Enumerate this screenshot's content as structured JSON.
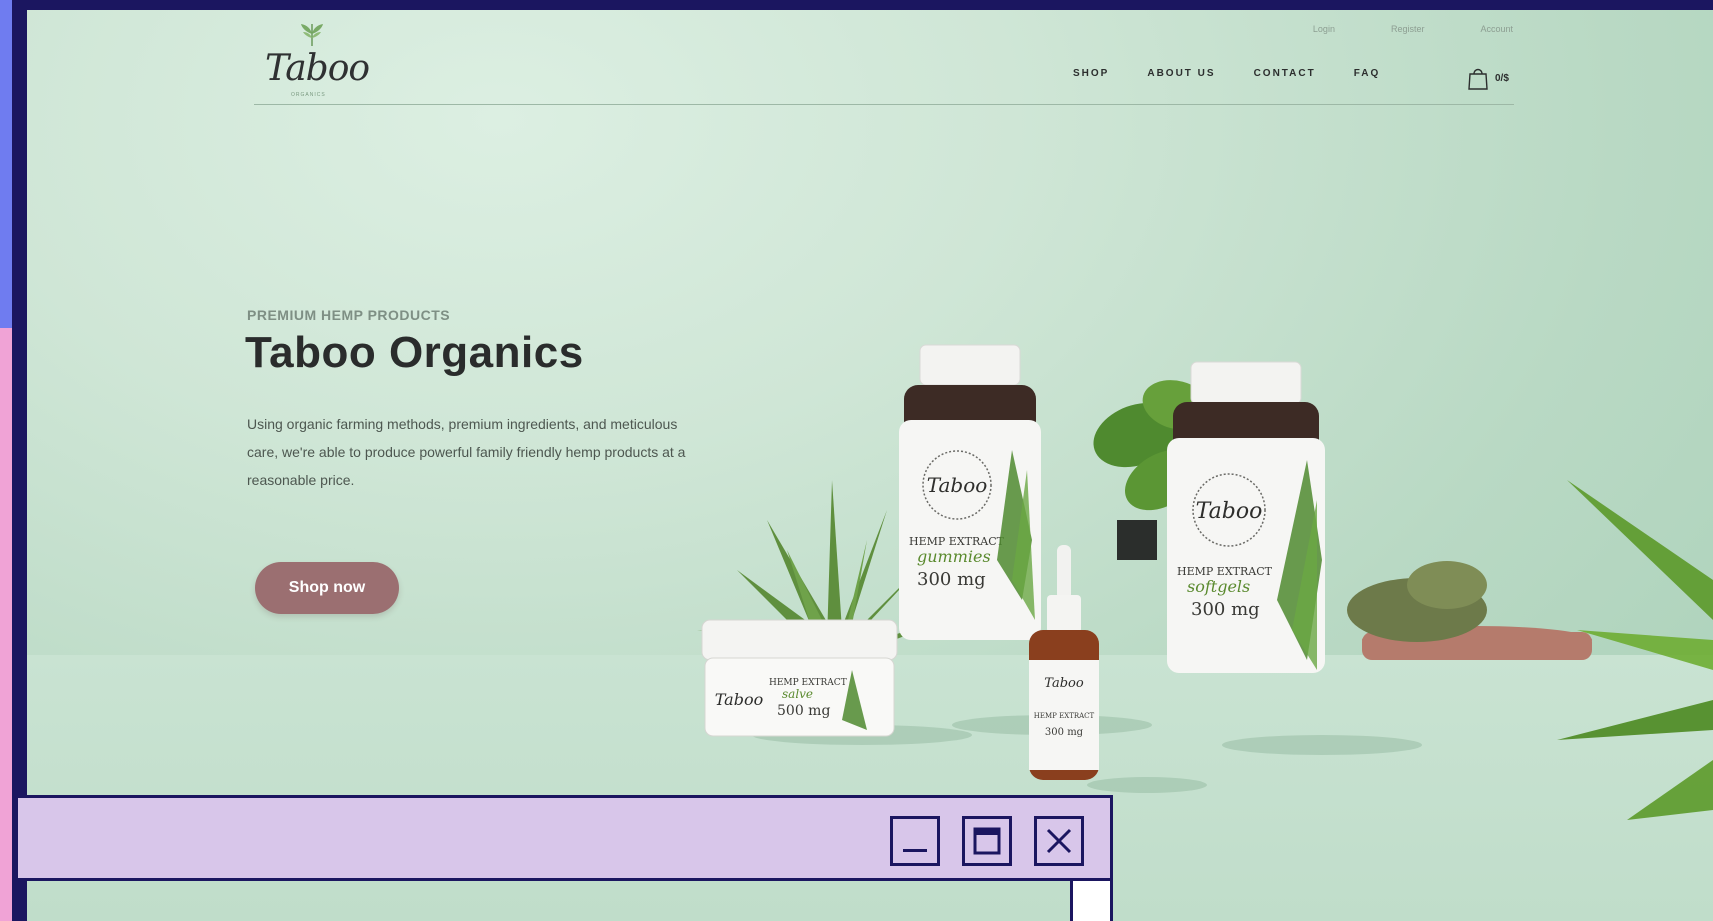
{
  "site": {
    "logo_text": "Taboo",
    "logo_sub": "ORGANICS",
    "top_links": [
      "Login",
      "Register",
      "Account"
    ],
    "nav": [
      "SHOP",
      "ABOUT US",
      "CONTACT",
      "FAQ"
    ],
    "cart_count": "0/$"
  },
  "hero": {
    "eyebrow": "PREMIUM HEMP PRODUCTS",
    "title": "Taboo Organics",
    "description": "Using organic farming methods, premium ingredients, and meticulous care, we're able to produce powerful family friendly hemp products at a reasonable price.",
    "cta": "Shop now"
  },
  "products": {
    "gummies": {
      "brand": "Taboo",
      "line1": "HEMP EXTRACT",
      "line2": "gummies",
      "dose": "300 mg"
    },
    "softgels": {
      "brand": "Taboo",
      "line1": "HEMP EXTRACT",
      "line2": "softgels",
      "dose": "300 mg"
    },
    "salve": {
      "brand": "Taboo",
      "line1": "HEMP EXTRACT",
      "line2": "salve",
      "dose": "500 mg"
    },
    "tincture": {
      "brand": "Taboo",
      "line1": "HEMP EXTRACT",
      "dose": "300 mg"
    }
  },
  "window": {
    "buttons": [
      "minimize-icon",
      "maximize-icon",
      "close-icon"
    ]
  },
  "colors": {
    "frame": "#1b1660",
    "window_bar": "#d8c6ea",
    "cta": "#9b6f71",
    "strip_blue": "#6f7cf0",
    "strip_pink": "#f0a3d6"
  }
}
